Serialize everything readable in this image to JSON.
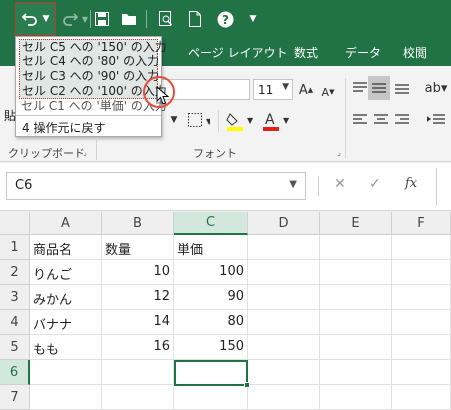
{
  "qat": {
    "undo_icon": "undo-icon",
    "redo_icon": "redo-icon",
    "save_icon": "save-icon",
    "open_icon": "open-folder-icon",
    "preview_icon": "print-preview-icon",
    "new_icon": "new-document-icon",
    "help_icon": "help-icon",
    "customize_icon": "customize-qat-icon"
  },
  "tabs": [
    "ページ レイアウト",
    "数式",
    "データ",
    "校閲"
  ],
  "ribbon": {
    "font_size": "11",
    "group_clipboard": "クリップボード",
    "group_font": "フォント",
    "clipboard_label_partial": "貼"
  },
  "formula_bar": {
    "name_box": "C6",
    "fx_label": "fx"
  },
  "grid": {
    "columns": [
      "A",
      "B",
      "C",
      "D",
      "E",
      "F"
    ],
    "rows": [
      "1",
      "2",
      "3",
      "4",
      "5",
      "6",
      "7"
    ],
    "cells": [
      [
        "商品名",
        "数量",
        "単価",
        "",
        "",
        ""
      ],
      [
        "りんご",
        "10",
        "100",
        "",
        "",
        ""
      ],
      [
        "みかん",
        "12",
        "90",
        "",
        "",
        ""
      ],
      [
        "バナナ",
        "14",
        "80",
        "",
        "",
        ""
      ],
      [
        "もも",
        "16",
        "150",
        "",
        "",
        ""
      ],
      [
        "",
        "",
        "",
        "",
        "",
        ""
      ],
      [
        "",
        "",
        "",
        "",
        "",
        ""
      ]
    ],
    "selected_cell": "C6"
  },
  "undo_menu": {
    "items": [
      "セル C5 への '150' の入力",
      "セル C4 への '80' の入力",
      "セル C3 への '90' の入力",
      "セル C2 への '100' の入力",
      "セル C1 への '単価' の入力"
    ],
    "footer": "4 操作元に戻す"
  },
  "colors": {
    "accent": "#217346",
    "highlight_border": "#c0392b"
  }
}
